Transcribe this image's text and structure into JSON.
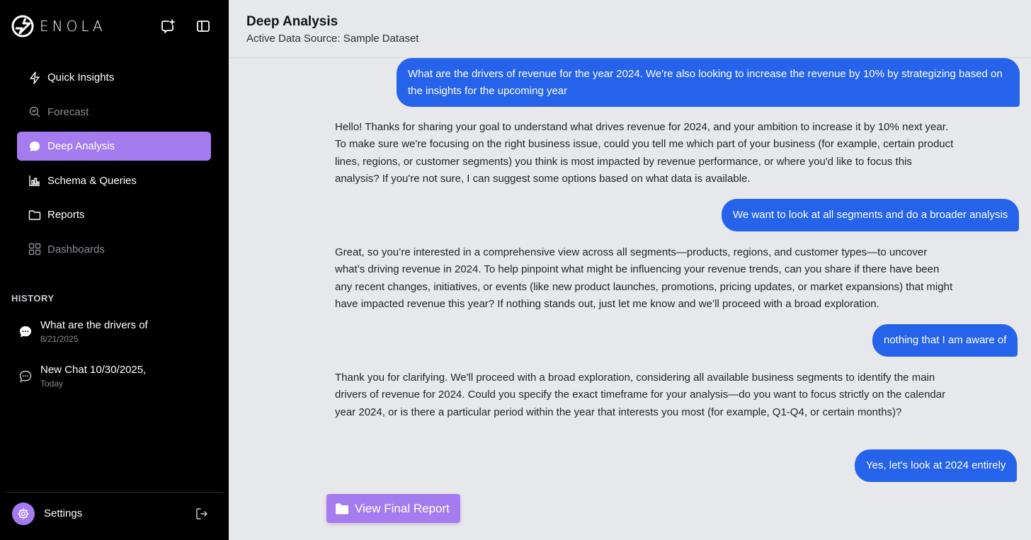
{
  "app": {
    "brand_name": "ENOLA",
    "accent_color": "#a57cf0",
    "bubble_color": "#2563eb"
  },
  "sidebar": {
    "top_icons": [
      "new-chat-icon",
      "sidebar-toggle-icon"
    ],
    "nav_items": [
      {
        "label": "Quick Insights",
        "icon": "lightning-icon",
        "state": "normal"
      },
      {
        "label": "Forecast",
        "icon": "search-chart-icon",
        "state": "muted"
      },
      {
        "label": "Deep Analysis",
        "icon": "chat-bubble-icon",
        "state": "active"
      },
      {
        "label": "Schema & Queries",
        "icon": "bar-chart-icon",
        "state": "normal"
      },
      {
        "label": "Reports",
        "icon": "folder-icon",
        "state": "normal"
      },
      {
        "label": "Dashboards",
        "icon": "grid-icon",
        "state": "muted"
      }
    ],
    "history_title": "HISTORY",
    "history": [
      {
        "title": "What are the drivers of",
        "date": "8/21/2025"
      },
      {
        "title": "New Chat 10/30/2025,",
        "date": "Today"
      }
    ],
    "settings_label": "Settings"
  },
  "header": {
    "title": "Deep Analysis",
    "subtitle": "Active Data Source: Sample Dataset"
  },
  "messages": [
    {
      "role": "user",
      "text": "What are the drivers of revenue for the year 2024. We're also looking to increase the revenue by 10% by strategizing based on the insights for the upcoming year"
    },
    {
      "role": "assistant",
      "text": "Hello! Thanks for sharing your goal to understand what drives revenue for 2024, and your ambition to increase it by 10% next year. To make sure we're focusing on the right business issue, could you tell me which part of your business (for example, certain product lines, regions, or customer segments) you think is most impacted by revenue performance, or where you'd like to focus this analysis? If you're not sure, I can suggest some options based on what data is available."
    },
    {
      "role": "user",
      "text": "We want to look at all segments and do a broader analysis"
    },
    {
      "role": "assistant",
      "text": "Great, so you’re interested in a comprehensive view across all segments—products, regions, and customer types—to uncover what’s driving revenue in 2024. To help pinpoint what might be influencing your revenue trends, can you share if there have been any recent changes, initiatives, or events (like new product launches, promotions, pricing updates, or market expansions) that might have impacted revenue this year? If nothing stands out, just let me know and we’ll proceed with a broad exploration."
    },
    {
      "role": "user",
      "text": "nothing that I am aware of"
    },
    {
      "role": "assistant",
      "text": "Thank you for clarifying. We'll proceed with a broad exploration, considering all available business segments to identify the main drivers of revenue for 2024. Could you specify the exact timeframe for your analysis—do you want to focus strictly on the calendar year 2024, or is there a particular period within the year that interests you most (for example, Q1-Q4, or certain months)?"
    },
    {
      "role": "user",
      "text": "Yes, let's look at 2024 entirely"
    }
  ],
  "actions": {
    "view_report_label": "View Final Report"
  }
}
